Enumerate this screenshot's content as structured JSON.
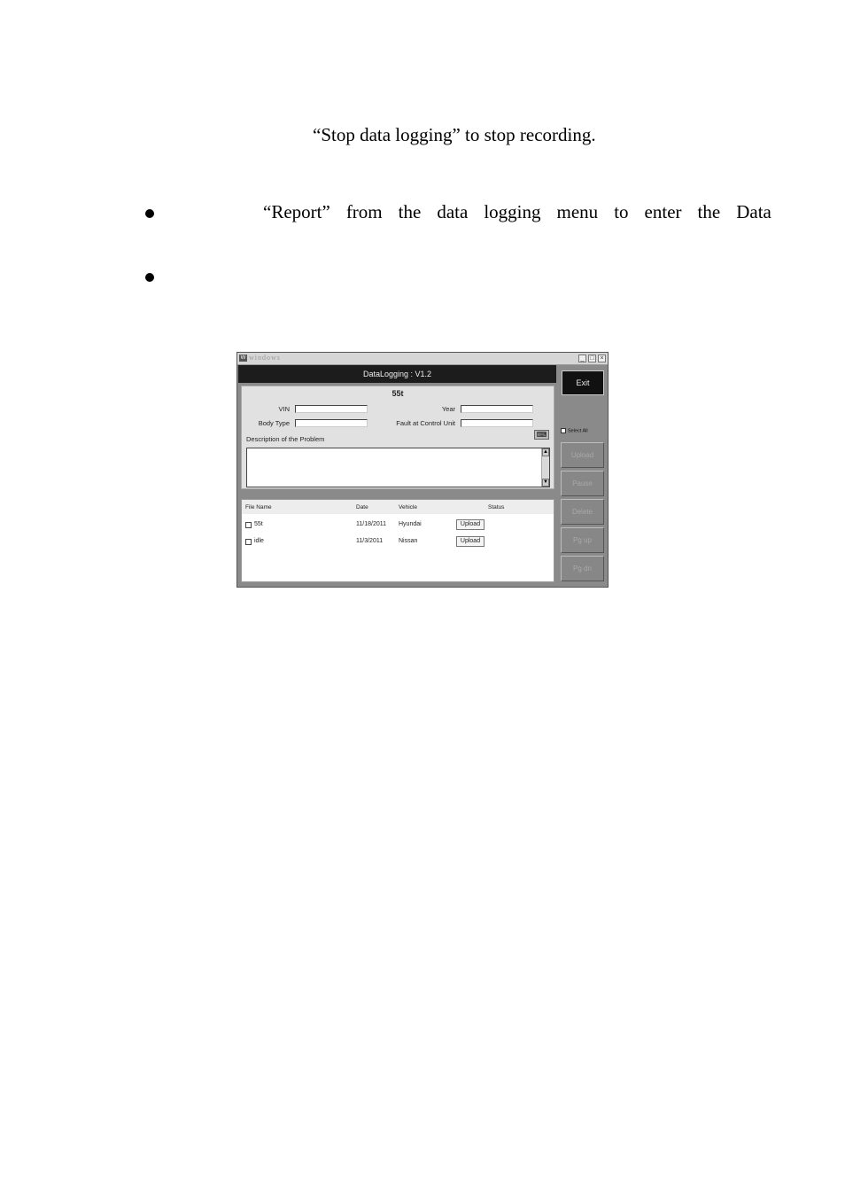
{
  "text": {
    "line1": "“Stop data logging” to stop recording.",
    "line2_words": [
      "“Report”",
      "from",
      "the",
      "data",
      "logging",
      "menu",
      "to",
      "enter",
      "the",
      "Data"
    ]
  },
  "window": {
    "title": "windows",
    "header": "DataLogging : V1.2",
    "report_title": "55t",
    "fields": {
      "vin_label": "VIN",
      "year_label": "Year",
      "body_type_label": "Body Type",
      "fault_label": "Fault at Control Unit",
      "description_label": "Description of the Problem"
    },
    "list": {
      "columns": [
        "File Name",
        "Date",
        "Vehicle",
        "Status"
      ],
      "rows": [
        {
          "file": "55t",
          "date": "11/18/2011",
          "vehicle": "Hyundai",
          "action": "Upload"
        },
        {
          "file": "idle",
          "date": "11/3/2011",
          "vehicle": "Nissan",
          "action": "Upload"
        }
      ]
    },
    "sidebar": {
      "exit": "Exit",
      "select_all": "Select All",
      "upload": "Upload",
      "pause": "Pause",
      "delete": "Delete",
      "pg_up": "Pg up",
      "pg_dn": "Pg dn"
    },
    "icons": {
      "keyboard": "keyboard-icon",
      "app": "app-icon"
    }
  }
}
